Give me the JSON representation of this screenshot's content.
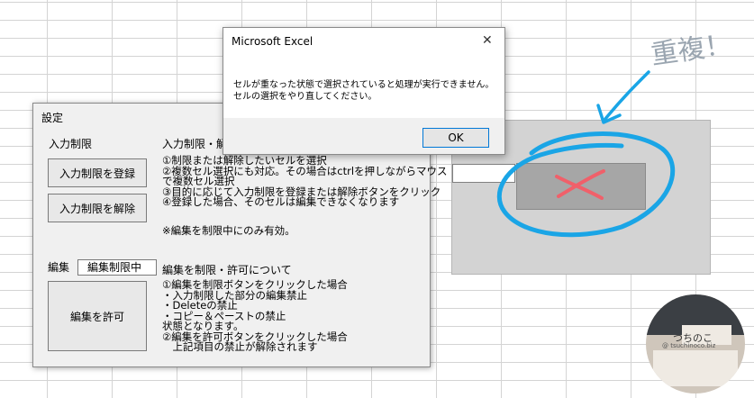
{
  "sheet": {},
  "settings_dialog": {
    "title": "設定",
    "input_restrict_label": "入力制限",
    "register_button": "入力制限を登録",
    "release_button": "入力制限を解除",
    "edit_label": "編集",
    "edit_status": "編集制限中",
    "allow_edit_button": "編集を許可",
    "info1_title": "入力制限・解",
    "info1_lines": [
      "①制限または解除したいセルを選択",
      "②複数セル選択にも対応。その場合はctrlを押しながらマウス",
      "で複数セル選択",
      "③目的に応じて入力制限を登録または解除ボタンをクリック",
      "④登録した場合、そのセルは編集できなくなります"
    ],
    "info1_note": "※編集を制限中にのみ有効。",
    "info2_title": "編集を制限・許可について",
    "info2_lines": [
      "①編集を制限ボタンをクリックした場合",
      "・入力制限した部分の編集禁止",
      "・Deleteの禁止",
      "・コピー＆ペーストの禁止",
      "状態となります。",
      "②編集を許可ボタンをクリックした場合",
      "　上記項目の禁止が解除されます"
    ]
  },
  "message_box": {
    "title": "Microsoft Excel",
    "close_glyph": "✕",
    "line1": "セルが重なった状態で選択されていると処理が実行できません。",
    "line2": "セルの選択をやり直してください。",
    "ok_button": "OK"
  },
  "annotation": {
    "text": "重複！",
    "circle_color": "#1aa5e6",
    "cross_color": "#f0606a"
  },
  "sticker": {
    "text": "つちのこ",
    "subtext": "@ tsuchinoco.biz"
  }
}
